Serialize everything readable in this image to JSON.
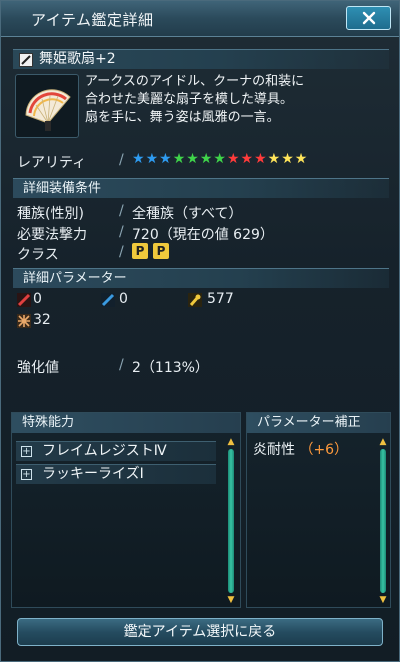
{
  "window": {
    "title": "アイテム鑑定詳細"
  },
  "item": {
    "name": "舞姫歌扇+2",
    "icon": "fan-weapon-icon",
    "description": [
      "アークスのアイドル、クーナの和装に",
      "合わせた美麗な扇子を模した導具。",
      "扇を手に、舞う姿は風雅の一言。"
    ]
  },
  "rarity": {
    "label": "レアリティ",
    "stars": 13,
    "star_colors": [
      "#2e9bf0",
      "#2e9bf0",
      "#2e9bf0",
      "#3fd34a",
      "#3fd34a",
      "#3fd34a",
      "#3fd34a",
      "#ff3b3b",
      "#ff3b3b",
      "#ff3b3b",
      "#ffe45a",
      "#ffe45a",
      "#ffe45a"
    ]
  },
  "requirements": {
    "header": "詳細装備条件",
    "race_label": "種族(性別)",
    "race_value": "全種族（すべて）",
    "attack_label": "必要法撃力",
    "attack_value": "720（現在の値 629）",
    "class_label": "クラス",
    "class_badges": [
      "P",
      "P"
    ]
  },
  "parameters": {
    "header": "詳細パラメーター",
    "melee": "0",
    "ranged": "0",
    "tech": "577",
    "dex": "32"
  },
  "grind": {
    "label": "強化値",
    "value": "2（113%）"
  },
  "special": {
    "header": "特殊能力",
    "items": [
      "フレイムレジストⅣ",
      "ラッキーライズⅠ"
    ]
  },
  "param_bonus": {
    "header": "パラメーター補正",
    "stat": "炎耐性",
    "value": "（+6）"
  },
  "footer": {
    "back_label": "鑑定アイテム選択に戻る"
  },
  "colors": {
    "accent": "#2e8fb3",
    "bonus": "#ff9a3c"
  }
}
